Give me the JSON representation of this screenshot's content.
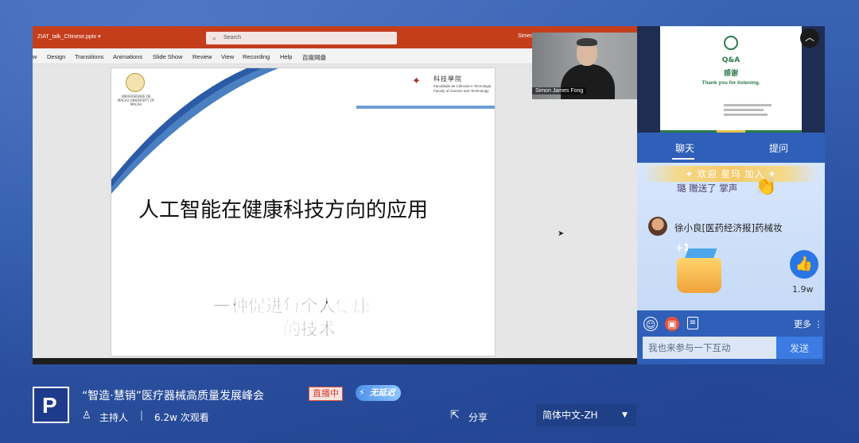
{
  "ppt": {
    "filename": "ZIAT_talk_Chinese.pptx ▾",
    "search_placeholder": "Search",
    "user_fragment": "Simeo",
    "ribbon": [
      "w",
      "Design",
      "Transitions",
      "Animations",
      "Slide Show",
      "Review",
      "View",
      "Recording",
      "Help",
      "百度网盘"
    ]
  },
  "slide": {
    "university_label": "UNIVERSIDADE DE MACAU UNIVERSITY OF MACAU",
    "faculty_cn": "科技學院",
    "faculty_en": "Faculdade de Ciências e Tecnologia Faculty of Science and Technology",
    "title": "人工智能在健康科技方向的应用",
    "subtitle_line1": "一种促进每个人健康",
    "subtitle_line2": "的技术"
  },
  "camera": {
    "speaker_name": "Simon James Fong"
  },
  "preview_slide": {
    "qa": "Q&A",
    "thanks_cn": "感谢",
    "thanks_en": "Thank you for listening."
  },
  "panel": {
    "tabs": [
      "聊天",
      "提问"
    ],
    "welcome": "✦ 欢迎  星玛  加入 ✦",
    "gift_message": "璐 赠送了 掌声",
    "chat_user": "徐小良[医药经济报]药械妆",
    "plus_one": "+1",
    "like_count": "1.9w",
    "more_label": "更多 ⋮",
    "input_placeholder": "我也来参与一下互动",
    "send_label": "发送"
  },
  "bottom": {
    "event_title": "“智造·慧销”医疗器械高质量发展峰会",
    "live_badge": "直播中",
    "nodelay_badge": "无延迟",
    "host_label": "主持人",
    "separator": "|",
    "view_count": "6.2w 次观看",
    "share_label": "分享",
    "language_selected": "简体中文-ZH"
  },
  "colors": {
    "ppt_accent": "#c43e1c",
    "panel_blue": "#2f5fb8",
    "like_blue": "#2a75e6",
    "live_red": "#d23e2a"
  }
}
